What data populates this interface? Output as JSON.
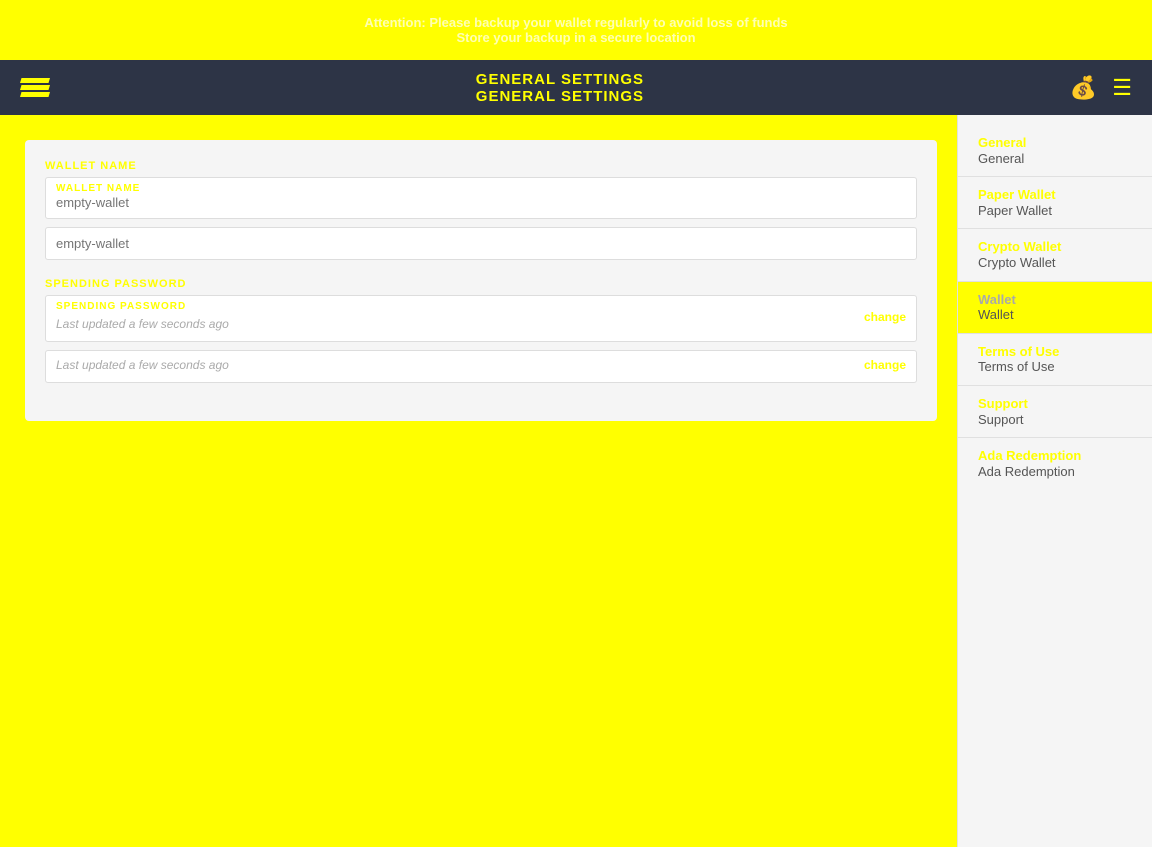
{
  "topBanner": {
    "line1": "Attention: Please backup your wallet regularly to avoid loss of funds",
    "line2": "Store your backup in a secure location"
  },
  "navbar": {
    "title1": "GENERAL SETTINGS",
    "title2": "GENERAL SETTINGS",
    "logoAlt": "Daedalus Logo"
  },
  "settings": {
    "walletNameLabel": "WALLET NAME",
    "walletNameFieldLabel": "WALLET NAME",
    "walletNamePlaceholder1": "empty-wallet",
    "walletNamePlaceholder2": "empty-wallet",
    "spendingPasswordLabel": "SPENDING PASSWORD",
    "spendingPasswordFieldLabel": "SPENDING PASSWORD",
    "lastUpdated1": "Last updated a few seconds ago",
    "lastUpdated2": "Last updated a few seconds ago",
    "changeLink1": "change",
    "changeLink2": "change"
  },
  "sidebar": {
    "items": [
      {
        "id": "general",
        "label": "General",
        "labelShadow": "General",
        "active": false
      },
      {
        "id": "paper-wallet",
        "label": "Paper Wallet",
        "labelShadow": "Paper Wallet",
        "active": false
      },
      {
        "id": "crypto-wallet",
        "label": "Crypto Wallet",
        "labelShadow": "Crypto Wallet",
        "active": false
      },
      {
        "id": "wallet",
        "label": "Wallet",
        "labelShadow": "Wallet",
        "active": true
      },
      {
        "id": "terms-of-use",
        "label": "Terms of Use",
        "labelShadow": "Terms of Use",
        "active": false
      },
      {
        "id": "support",
        "label": "Support",
        "labelShadow": "Support",
        "active": false
      },
      {
        "id": "ada-redemption",
        "label": "Ada Redemption",
        "labelShadow": "Ada Redemption",
        "active": false
      }
    ]
  }
}
